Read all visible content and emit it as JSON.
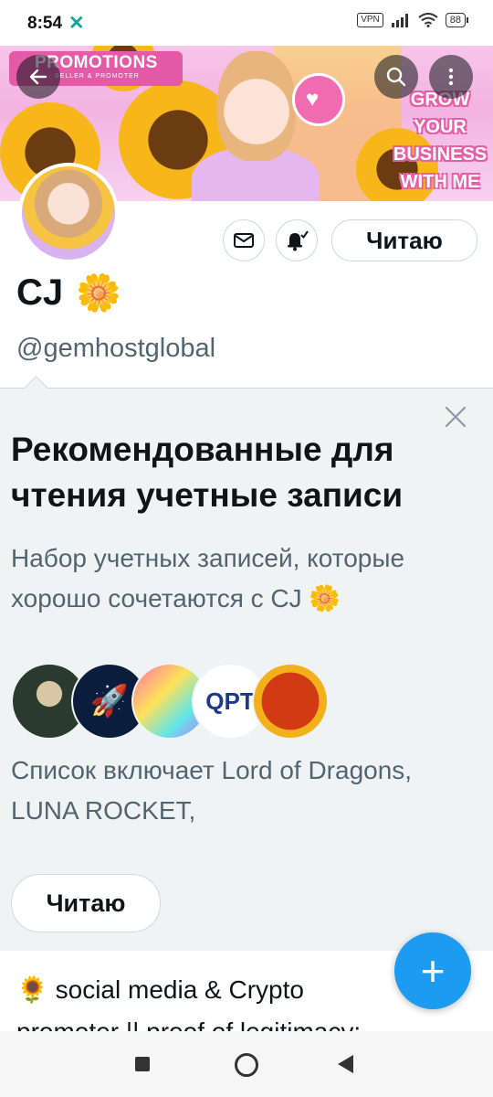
{
  "status_bar": {
    "time": "8:54",
    "app_indicator": "✕",
    "vpn": "VPN",
    "battery": "88"
  },
  "banner": {
    "promo_title": "PROMOTIONS",
    "promo_subtitle": "SELLER & PROMOTER",
    "grow_lines": [
      "GROW",
      "YOUR",
      "BUSINESS",
      "WITH ME"
    ]
  },
  "header_icons": {
    "back": "arrow-left-icon",
    "search": "search-icon",
    "more": "more-vertical-icon"
  },
  "profile": {
    "name": "CJ",
    "name_emoji": "🌼",
    "handle": "@gemhostglobal",
    "follow_label": "Читаю"
  },
  "recommendation": {
    "title": "Рекомендованные для чтения учетные записи",
    "description": "Набор учетных записей, которые хорошо сочетаются с CJ 🌼",
    "includes": "Список включает Lord of Dragons, LUNA ROCKET,",
    "follow_label": "Читаю",
    "avatar_labels": [
      "",
      "🚀",
      "",
      "QPT",
      ""
    ]
  },
  "bio": {
    "line1": "🌻 social media & Crypto",
    "line2": "promoter || proof of legitimacy:"
  },
  "fab": {
    "label": "+"
  },
  "colors": {
    "accent": "#1d9bf0",
    "text": "#0f1419",
    "secondary": "#536471",
    "card_bg": "#eff3f4",
    "border": "#cfd9de"
  }
}
